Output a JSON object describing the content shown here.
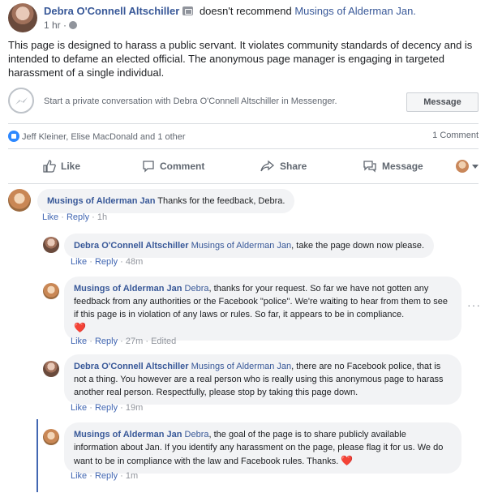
{
  "post": {
    "author": "Debra O'Connell Altschiller",
    "action_text": "doesn't recommend",
    "page_name": "Musings of Alderman Jan.",
    "time": "1 hr",
    "body": "This page is designed to harass a public servant. It violates community standards of decency and is intended to defame an elected official. The anonymous page manager is engaging in targeted harassment of a single individual."
  },
  "messenger": {
    "prompt": "Start a private conversation with Debra O'Connell Altschiller in Messenger.",
    "button_label": "Message"
  },
  "reactions": {
    "names": "Jeff Kleiner, Elise MacDonald and 1 other",
    "comment_count": "1 Comment"
  },
  "actions": {
    "like": "Like",
    "comment": "Comment",
    "share": "Share",
    "message": "Message"
  },
  "comments": [
    {
      "author": "Musings of Alderman Jan",
      "mention": "",
      "text": " Thanks for the feedback, Debra.",
      "like": "Like",
      "reply": "Reply",
      "time": "1h",
      "edited": ""
    },
    {
      "author": "Debra O'Connell Altschiller",
      "mention": "Musings of Alderman Jan",
      "text": ", take the page down now please.",
      "like": "Like",
      "reply": "Reply",
      "time": "48m",
      "edited": ""
    },
    {
      "author": "Musings of Alderman Jan",
      "mention": "Debra",
      "text": ", thanks for your request. So far we have not gotten any feedback from any authorities or the Facebook \"police\". We're waiting to hear from them to see if this page is in violation of any laws or rules. So far, it appears to be in compliance.",
      "heart": "❤️",
      "like": "Like",
      "reply": "Reply",
      "time": "27m",
      "edited": "Edited"
    },
    {
      "author": "Debra O'Connell Altschiller",
      "mention": "Musings of Alderman Jan",
      "text": ", there are no Facebook police, that is not a thing. You however are a real person who is really using this anonymous page to harass another real person. Respectfully, please stop by taking this page down.",
      "like": "Like",
      "reply": "Reply",
      "time": "19m",
      "edited": ""
    },
    {
      "author": "Musings of Alderman Jan",
      "mention": "Debra",
      "text": ", the goal of the page is to share publicly available information about Jan. If you identify any harassment on the page, please flag it for us. We do want to be in compliance with the law and Facebook rules. Thanks.",
      "heart": "❤️",
      "like": "Like",
      "reply": "Reply",
      "time": "1m",
      "edited": ""
    }
  ],
  "colors": {
    "link": "#385898",
    "bubble": "#f2f3f5",
    "thread_line": "#4267b2",
    "like_blue": "#2d88ff"
  }
}
